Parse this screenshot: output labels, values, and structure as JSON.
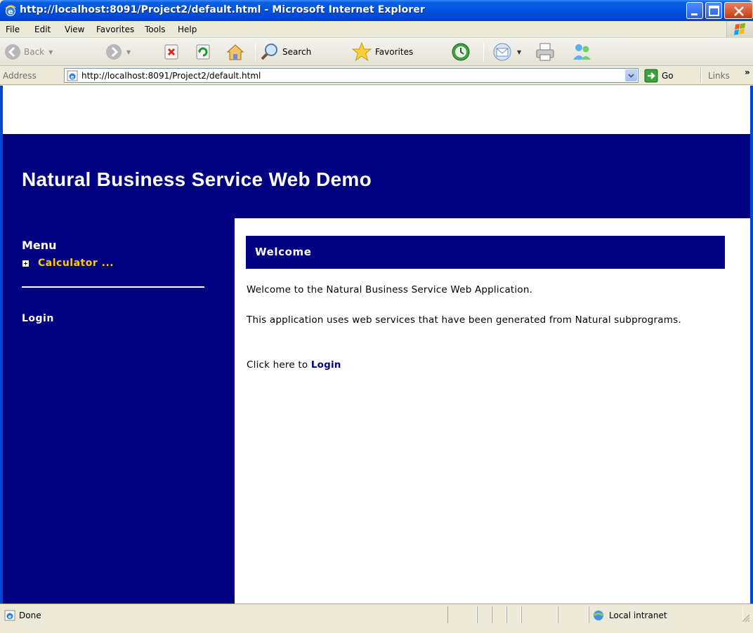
{
  "window": {
    "title": "http://localhost:8091/Project2/default.html - Microsoft Internet Explorer"
  },
  "menubar": {
    "items": [
      "File",
      "Edit",
      "View",
      "Favorites",
      "Tools",
      "Help"
    ]
  },
  "toolbar": {
    "back_label": "Back",
    "search_label": "Search",
    "favorites_label": "Favorites"
  },
  "addressbar": {
    "label": "Address",
    "url": "http://localhost:8091/Project2/default.html",
    "go_label": "Go",
    "links_label": "Links",
    "links_more": "»"
  },
  "page": {
    "banner_title": "Natural Business Service Web Demo",
    "sidebar": {
      "menu_heading": "Menu",
      "calculator_item": "Calculator ...",
      "login_item": "Login"
    },
    "main": {
      "welcome_heading": "Welcome",
      "paragraph1": "Welcome to the Natural Business Service Web Application.",
      "paragraph2": "This application uses web services that have been generated from Natural subprograms.",
      "paragraph3_prefix": "Click here to ",
      "paragraph3_link": "Login"
    },
    "colors": {
      "navy": "#000080",
      "menu_highlight": "#ffcc00"
    }
  },
  "statusbar": {
    "status": "Done",
    "zone": "Local intranet"
  }
}
